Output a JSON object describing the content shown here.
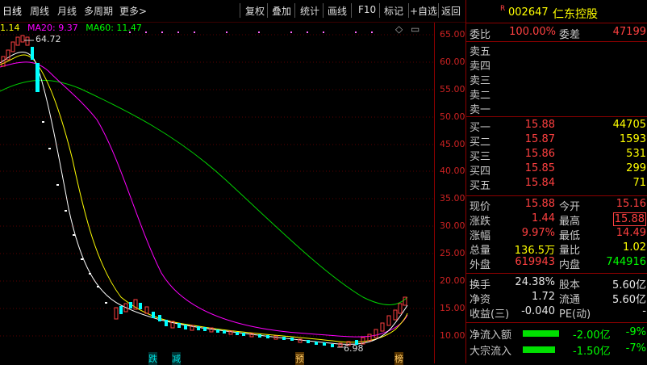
{
  "toolbar": {
    "periods": [
      "日线",
      "周线",
      "月线",
      "多周期",
      "更多>"
    ],
    "buttons": [
      "复权",
      "叠加",
      "统计",
      "画线",
      "F10",
      "标记",
      "+自选",
      "返回"
    ]
  },
  "ma": {
    "ma5": "1.14",
    "ma20": "MA20: 9.37",
    "ma60": "MA60: 11.47"
  },
  "annotations": {
    "high": "64.72",
    "low": "6.98",
    "markers": [
      "跌",
      "减",
      "预",
      "榜"
    ]
  },
  "y_ticks": [
    "65.00",
    "60.00",
    "55.00",
    "50.00",
    "45.00",
    "40.00",
    "35.00",
    "30.00",
    "25.00",
    "20.00",
    "15.00",
    "10.00"
  ],
  "stock": {
    "badge": "R",
    "code": "002647",
    "name": "仁东控股"
  },
  "weibi": {
    "label": "委比",
    "value": "100.00%",
    "label2": "委差",
    "value2": "47199"
  },
  "sell": [
    {
      "label": "卖五"
    },
    {
      "label": "卖四"
    },
    {
      "label": "卖三"
    },
    {
      "label": "卖二"
    },
    {
      "label": "卖一"
    }
  ],
  "buy": [
    {
      "label": "买一",
      "price": "15.88",
      "vol": "44705"
    },
    {
      "label": "买二",
      "price": "15.87",
      "vol": "1593"
    },
    {
      "label": "买三",
      "price": "15.86",
      "vol": "531"
    },
    {
      "label": "买四",
      "price": "15.85",
      "vol": "299"
    },
    {
      "label": "买五",
      "price": "15.84",
      "vol": "71"
    }
  ],
  "quote": [
    {
      "l1": "现价",
      "v1": "15.88",
      "l2": "今开",
      "v2": "15.16"
    },
    {
      "l1": "涨跌",
      "v1": "1.44",
      "l2": "最高",
      "v2": "15.88"
    },
    {
      "l1": "涨幅",
      "v1": "9.97%",
      "l2": "最低",
      "v2": "14.49"
    },
    {
      "l1": "总量",
      "v1": "136.5万",
      "l2": "量比",
      "v2": "1.02"
    },
    {
      "l1": "外盘",
      "v1": "619943",
      "l2": "内盘",
      "v2": "744916"
    }
  ],
  "fund": [
    {
      "l1": "换手",
      "v1": "24.38%",
      "l2": "股本",
      "v2": "5.60亿"
    },
    {
      "l1": "净资",
      "v1": "1.72",
      "l2": "流通",
      "v2": "5.60亿"
    },
    {
      "l1": "收益(三)",
      "v1": "-0.040",
      "l2": "PE(动)",
      "v2": "-"
    }
  ],
  "flows": [
    {
      "label": "净流入额",
      "value": "-2.00亿",
      "pct": "-9%"
    },
    {
      "label": "大宗流入",
      "value": "-1.50亿",
      "pct": "-7%"
    }
  ],
  "colors": {
    "up": "#ff4040",
    "down": "#00ffff",
    "ma5": "#ffffff",
    "ma10": "#ffff00",
    "ma20": "#ff00ff",
    "ma60": "#00ff00"
  }
}
